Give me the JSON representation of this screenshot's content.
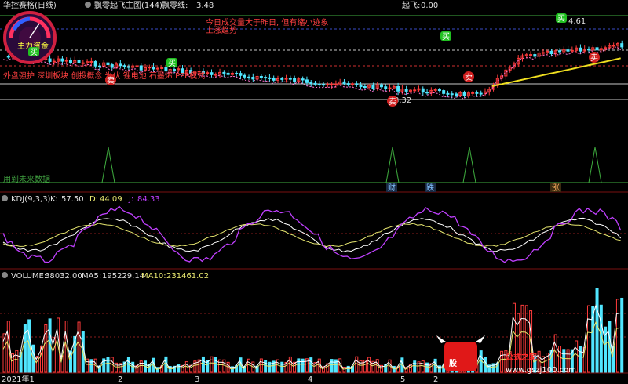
{
  "header": {
    "stock_name": "华控赛格(日线)",
    "indicator_name": "飘零起飞主图(144)",
    "line_label": "飘零线:",
    "line_value": "3.48",
    "right_label": "起飞:",
    "right_value": "0.00"
  },
  "main_panel": {
    "y_top_label": "4.61",
    "y_low_label": "3.32",
    "signal_text_1": "今日成交量大于昨日, 但有缩小迹象",
    "signal_text_2": "上涨趋势",
    "signal_text_3": "外盘强护 深圳板块 创投概念 光伏 锂电池 石墨烯 PPP模式",
    "signal_text_4": "用到未来数据",
    "gauge_label": "主力资金",
    "marker_buy": "买",
    "marker_sell": "卖",
    "band_tags": [
      "财",
      "跌",
      "涨"
    ]
  },
  "kdj": {
    "title": "KDJ(9,3,3)",
    "k_label": "K:",
    "k_value": "57.50",
    "d_label": "D:",
    "d_value": "44.09",
    "j_label": "J:",
    "j_value": "84.33"
  },
  "volume": {
    "title": "VOLUME:",
    "value": "38032.00",
    "ma5_label": "MA5:",
    "ma5_value": "195229.14",
    "ma10_label": "MA10:",
    "ma10_value": "231461.02"
  },
  "x_axis": {
    "labels": [
      "2021年1",
      "2",
      "3",
      "4",
      "5",
      "2"
    ]
  },
  "watermark": {
    "logo_char": "股",
    "title": "公式之家",
    "url": "www.gszj100.com"
  },
  "colors": {
    "up": "#ff3b3b",
    "down": "#50e6ff",
    "ma_yellow": "#f0e020",
    "k_line": "#ffffff",
    "d_line": "#e8e870",
    "j_line": "#c040ff",
    "grid": "#8a1c1c",
    "signal_green": "#20c020"
  },
  "chart_data": {
    "type": "candlestick",
    "price_labels": {
      "high": 4.61,
      "low": 3.32
    },
    "kdj_latest": {
      "K": 57.5,
      "D": 44.09,
      "J": 84.33
    },
    "volume_latest": {
      "VOLUME": 38032.0,
      "MA5": 195229.14,
      "MA10": 231461.02
    }
  }
}
